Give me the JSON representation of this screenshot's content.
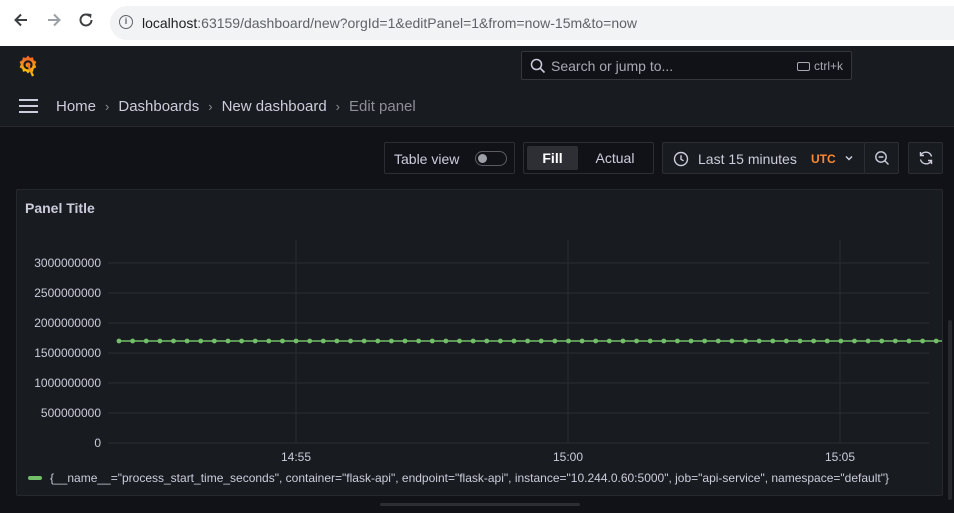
{
  "browser": {
    "url_host": "localhost",
    "url_rest": ":63159/dashboard/new?orgId=1&editPanel=1&from=now-15m&to=now"
  },
  "topbar": {
    "search_placeholder": "Search or jump to...",
    "shortcut": "ctrl+k"
  },
  "breadcrumb": {
    "items": [
      "Home",
      "Dashboards",
      "New dashboard"
    ],
    "current": "Edit panel"
  },
  "toolbar": {
    "table_view_label": "Table view",
    "table_view_on": false,
    "fill_label": "Fill",
    "actual_label": "Actual",
    "time_range": "Last 15 minutes",
    "timezone": "UTC",
    "icons": [
      "clock-icon",
      "chevron-down-icon",
      "zoom-out-icon",
      "refresh-icon"
    ]
  },
  "panel": {
    "title": "Panel Title",
    "legend": "{__name__=\"process_start_time_seconds\", container=\"flask-api\", endpoint=\"flask-api\", instance=\"10.244.0.60:5000\", job=\"api-service\", namespace=\"default\"}"
  },
  "colors": {
    "series": "#73bf69",
    "utc": "#ff8833",
    "background": "#111217",
    "panel": "#181b1f"
  },
  "chart_data": {
    "type": "line",
    "title": "Panel Title",
    "ylim": [
      0,
      3000000000
    ],
    "y_ticks": [
      "0",
      "500000000",
      "1000000000",
      "1500000000",
      "2000000000",
      "2500000000",
      "3000000000"
    ],
    "x_ticks": [
      "14:55",
      "15:00",
      "15:05"
    ],
    "grid": true,
    "legend_placement": "bottom-left",
    "series": [
      {
        "name": "{__name__=\"process_start_time_seconds\", container=\"flask-api\", endpoint=\"flask-api\", instance=\"10.244.0.60:5000\", job=\"api-service\", namespace=\"default\"}",
        "constant_value": 1700000000,
        "points": 67
      }
    ]
  }
}
